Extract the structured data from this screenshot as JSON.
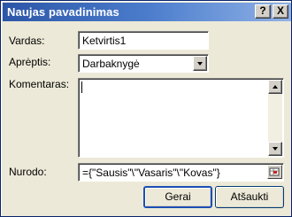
{
  "window": {
    "title": "Naujas pavadinimas",
    "help_glyph": "?",
    "close_glyph": "X"
  },
  "form": {
    "name_label": "Vardas:",
    "name_value": "Ketvirtis1",
    "scope_label": "Aprėptis:",
    "scope_value": "Darbaknygė",
    "comment_label": "Komentaras:",
    "comment_value": "",
    "refers_label": "Nurodo:",
    "refers_value": "={\"Sausis\"\\\"Vasaris\"\\\"Kovas\"}"
  },
  "buttons": {
    "ok": "Gerai",
    "cancel": "Atšaukti"
  },
  "colors": {
    "title_start": "#2c56a8",
    "title_end": "#8fb2e6",
    "dialog_bg": "#ece9d8",
    "focus_border": "#1c4fb4"
  }
}
